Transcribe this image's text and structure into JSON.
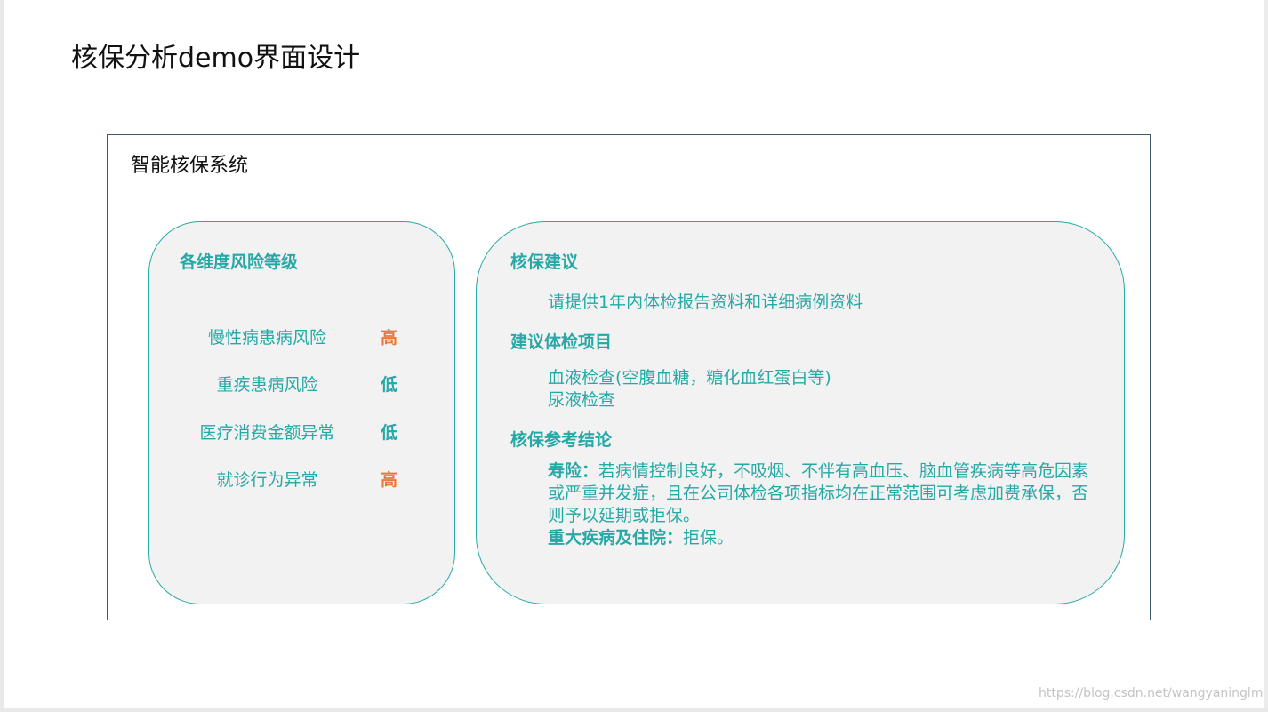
{
  "page": {
    "title": "核保分析demo界面设计"
  },
  "system": {
    "title": "智能核保系统"
  },
  "risk_panel": {
    "heading": "各维度风险等级",
    "items": [
      {
        "label": "慢性病患病风险",
        "level": "高",
        "level_color": "#e8773f"
      },
      {
        "label": "重疾患病风险",
        "level": "低",
        "level_color": "#26a9a6"
      },
      {
        "label": "医疗消费金额异常",
        "level": "低",
        "level_color": "#26a9a6"
      },
      {
        "label": "就诊行为异常",
        "level": "高",
        "level_color": "#e8773f"
      }
    ]
  },
  "advice_panel": {
    "advice_heading": "核保建议",
    "advice_text": "请提供1年内体检报告资料和详细病例资料",
    "exam_heading": "建议体检项目",
    "exam_items": [
      "血液检查(空腹血糖，糖化血红蛋白等)",
      "尿液检查"
    ],
    "conclusion_heading": "核保参考结论",
    "life_label": "寿险：",
    "life_text": "若病情控制良好，不吸烟、不伴有高血压、脑血管疾病等高危因素或严重并发症，且在公司体检各项指标均在正常范围可考虑加费承保，否则予以延期或拒保。",
    "critical_label": "重大疾病及住院：",
    "critical_text": "拒保。"
  },
  "watermark": "https://blog.csdn.net/wangyaninglm",
  "colors": {
    "accent": "#26a9a6",
    "high": "#e8773f",
    "panel_bg": "#f2f2f2",
    "frame_border": "#3d5a6b"
  }
}
